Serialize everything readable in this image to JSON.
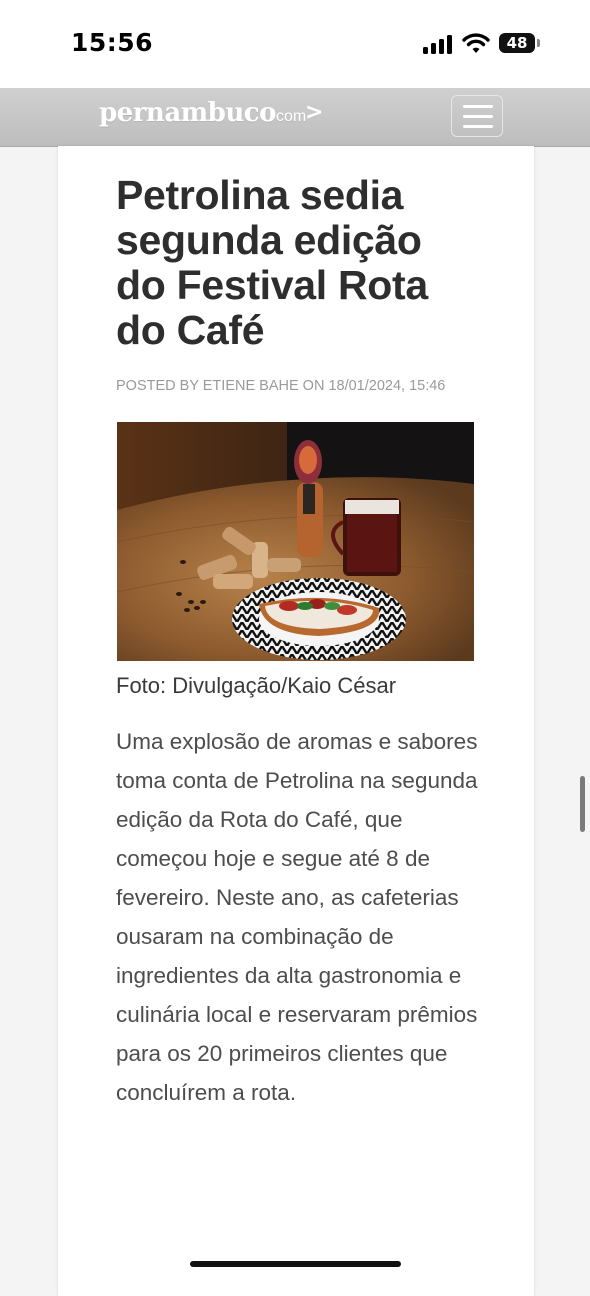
{
  "status_bar": {
    "time": "15:56",
    "battery": "48"
  },
  "header": {
    "logo_main": "pernambuco",
    "logo_suffix": "com",
    "logo_arrow": ">"
  },
  "article": {
    "title": "Petrolina sedia segunda edição do Festival Rota do Café",
    "meta": "POSTED BY ETIENE BAHE ON 18/01/2024, 15:46",
    "photo_caption": "Foto: Divulgação/Kaio César",
    "body": "Uma explosão de aromas e sabores toma conta de Petrolina na segunda edição da Rota do Café, que começou hoje e segue até 8 de fevereiro. Neste ano, as cafeterias ousaram na combinação de ingredientes da alta gastronomia e culinária local e reservaram prêmios para os 20 primeiros clientes que concluírem a rota."
  },
  "icons": {
    "signal": "cellular-signal-icon",
    "wifi": "wifi-icon",
    "battery": "battery-icon",
    "menu": "hamburger-menu-icon"
  }
}
